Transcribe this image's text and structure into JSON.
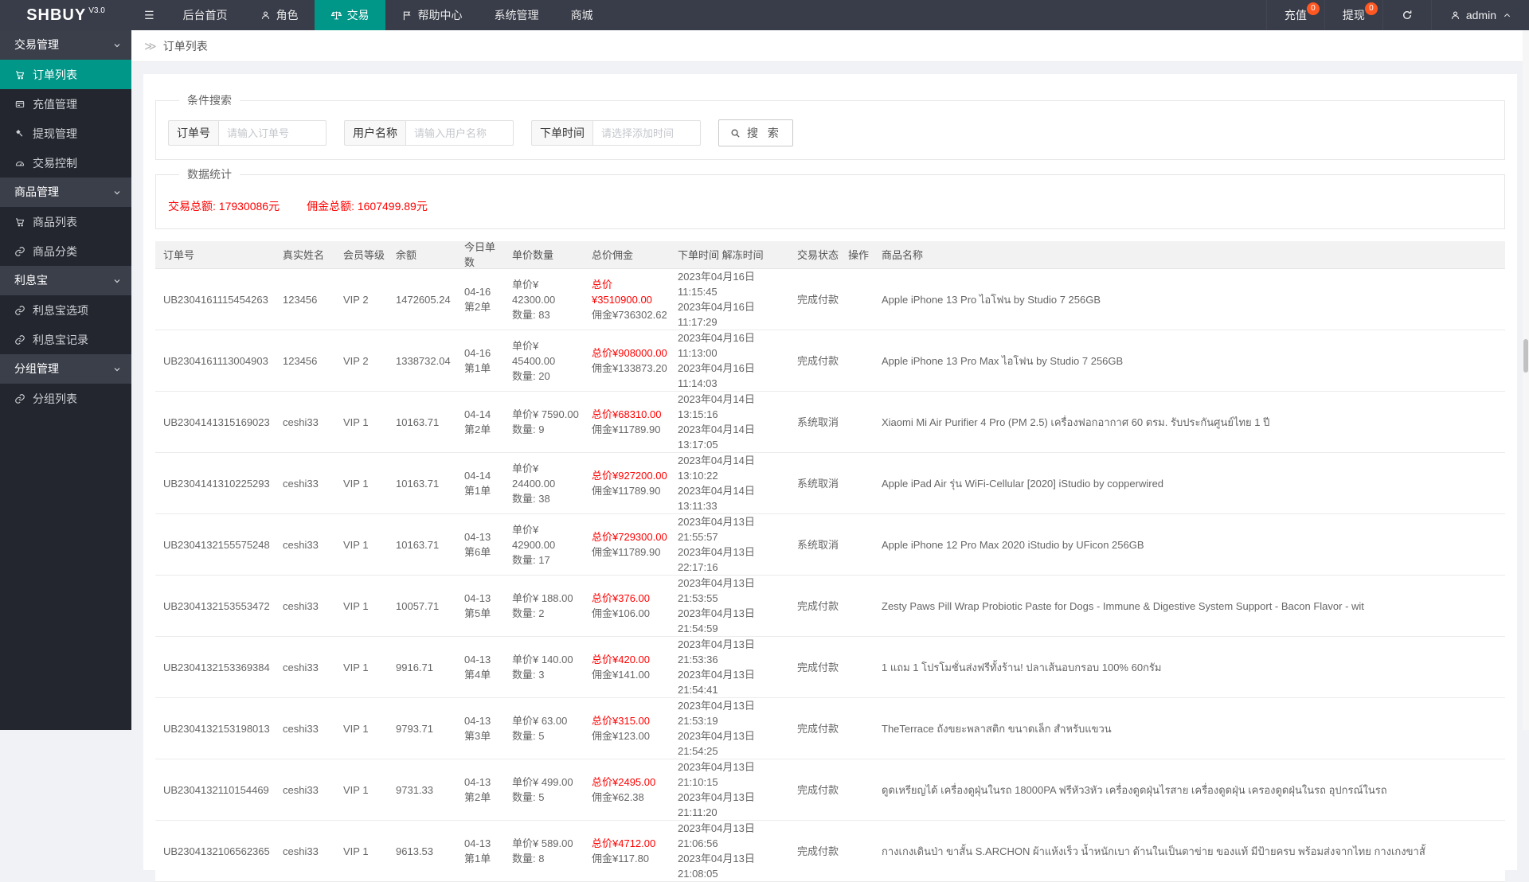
{
  "colors": {
    "accent": "#009688",
    "badge": "#ff5722",
    "alert_red": "#ff0000"
  },
  "topbar": {
    "logo": "SHBUY",
    "logo_version": "V3.0",
    "menu": [
      {
        "label": "后台首页"
      },
      {
        "label": "角色",
        "icon": "person-icon"
      },
      {
        "label": "交易",
        "icon": "scales-icon",
        "active": true
      },
      {
        "label": "帮助中心",
        "icon": "flag-icon"
      },
      {
        "label": "系统管理"
      },
      {
        "label": "商城"
      }
    ],
    "right": {
      "recharge_label": "充值",
      "recharge_badge": "0",
      "withdraw_label": "提现",
      "withdraw_badge": "0",
      "username": "admin"
    }
  },
  "sidebar": {
    "items": [
      {
        "type": "group",
        "label": "交易管理"
      },
      {
        "type": "item",
        "label": "订单列表",
        "icon": "cart-icon",
        "active": true
      },
      {
        "type": "item",
        "label": "充值管理",
        "icon": "card-icon"
      },
      {
        "type": "item",
        "label": "提现管理",
        "icon": "gavel-icon"
      },
      {
        "type": "item",
        "label": "交易控制",
        "icon": "gauge-icon"
      },
      {
        "type": "group",
        "label": "商品管理"
      },
      {
        "type": "item",
        "label": "商品列表",
        "icon": "cart-icon"
      },
      {
        "type": "item",
        "label": "商品分类",
        "icon": "link-icon"
      },
      {
        "type": "group",
        "label": "利息宝"
      },
      {
        "type": "item",
        "label": "利息宝选项",
        "icon": "link-icon"
      },
      {
        "type": "item",
        "label": "利息宝记录",
        "icon": "link-icon"
      },
      {
        "type": "group",
        "label": "分组管理"
      },
      {
        "type": "item",
        "label": "分组列表",
        "icon": "link-icon"
      }
    ]
  },
  "breadcrumb": {
    "page": "订单列表"
  },
  "search": {
    "legend": "条件搜索",
    "fields": [
      {
        "label": "订单号",
        "placeholder": "请输入订单号",
        "value": ""
      },
      {
        "label": "用户名称",
        "placeholder": "请输入用户名称",
        "value": ""
      },
      {
        "label": "下单时间",
        "placeholder": "请选择添加时间",
        "value": ""
      }
    ],
    "button_label": "搜 索"
  },
  "stats": {
    "legend": "数据统计",
    "trade_total": "交易总额: 17930086元",
    "commission_total": "佣金总额: 1607499.89元"
  },
  "table": {
    "headers": [
      "订单号",
      "真实姓名",
      "会员等级",
      "余额",
      "今日单数",
      "单价数量",
      "总价佣金",
      "下单时间 解冻时间",
      "交易状态",
      "操作",
      "商品名称"
    ],
    "rows": [
      {
        "order_no": "UB2304161115454263",
        "real_name": "123456",
        "vip": "VIP 2",
        "balance": "1472605.24",
        "date": "04-16",
        "seq": "第2单",
        "unit_price": "单价¥ 42300.00",
        "qty": "数量: 83",
        "total": "总价¥3510900.00",
        "commission": "佣金¥736302.62",
        "order_time": "2023年04月16日 11:15:45",
        "unfreeze_time": "2023年04月16日 11:17:29",
        "status": "完成付款",
        "product": "Apple iPhone 13 Pro ไอโฟน by Studio 7 256GB"
      },
      {
        "order_no": "UB2304161113004903",
        "real_name": "123456",
        "vip": "VIP 2",
        "balance": "1338732.04",
        "date": "04-16",
        "seq": "第1单",
        "unit_price": "单价¥ 45400.00",
        "qty": "数量: 20",
        "total": "总价¥908000.00",
        "commission": "佣金¥133873.20",
        "order_time": "2023年04月16日 11:13:00",
        "unfreeze_time": "2023年04月16日 11:14:03",
        "status": "完成付款",
        "product": "Apple iPhone 13 Pro Max ไอโฟน by Studio 7 256GB"
      },
      {
        "order_no": "UB2304141315169023",
        "real_name": "ceshi33",
        "vip": "VIP 1",
        "balance": "10163.71",
        "date": "04-14",
        "seq": "第2单",
        "unit_price": "单价¥ 7590.00",
        "qty": "数量: 9",
        "total": "总价¥68310.00",
        "commission": "佣金¥11789.90",
        "order_time": "2023年04月14日 13:15:16",
        "unfreeze_time": "2023年04月14日 13:17:05",
        "status": "系统取消",
        "product": "Xiaomi Mi Air Purifier 4 Pro (PM 2.5) เครื่องฟอกอากาศ 60 ตรม. รับประกันศูนย์ไทย 1 ปี"
      },
      {
        "order_no": "UB2304141310225293",
        "real_name": "ceshi33",
        "vip": "VIP 1",
        "balance": "10163.71",
        "date": "04-14",
        "seq": "第1单",
        "unit_price": "单价¥ 24400.00",
        "qty": "数量: 38",
        "total": "总价¥927200.00",
        "commission": "佣金¥11789.90",
        "order_time": "2023年04月14日 13:10:22",
        "unfreeze_time": "2023年04月14日 13:11:33",
        "status": "系统取消",
        "product": "Apple iPad Air รุ่น WiFi-Cellular [2020] iStudio by copperwired"
      },
      {
        "order_no": "UB2304132155575248",
        "real_name": "ceshi33",
        "vip": "VIP 1",
        "balance": "10163.71",
        "date": "04-13",
        "seq": "第6单",
        "unit_price": "单价¥ 42900.00",
        "qty": "数量: 17",
        "total": "总价¥729300.00",
        "commission": "佣金¥11789.90",
        "order_time": "2023年04月13日 21:55:57",
        "unfreeze_time": "2023年04月13日 22:17:16",
        "status": "系统取消",
        "product": "Apple iPhone 12 Pro Max 2020 iStudio by UFicon 256GB"
      },
      {
        "order_no": "UB2304132153553472",
        "real_name": "ceshi33",
        "vip": "VIP 1",
        "balance": "10057.71",
        "date": "04-13",
        "seq": "第5单",
        "unit_price": "单价¥ 188.00",
        "qty": "数量: 2",
        "total": "总价¥376.00",
        "commission": "佣金¥106.00",
        "order_time": "2023年04月13日 21:53:55",
        "unfreeze_time": "2023年04月13日 21:54:59",
        "status": "完成付款",
        "product": "Zesty Paws Pill Wrap Probiotic Paste for Dogs - Immune & Digestive System Support - Bacon Flavor - wit"
      },
      {
        "order_no": "UB2304132153369384",
        "real_name": "ceshi33",
        "vip": "VIP 1",
        "balance": "9916.71",
        "date": "04-13",
        "seq": "第4单",
        "unit_price": "单价¥ 140.00",
        "qty": "数量: 3",
        "total": "总价¥420.00",
        "commission": "佣金¥141.00",
        "order_time": "2023年04月13日 21:53:36",
        "unfreeze_time": "2023年04月13日 21:54:41",
        "status": "完成付款",
        "product": "1 แถม 1 โปรโมชั่นส่งฟรีทั้งร้าน! ปลาเส้นอบกรอบ 100% 60กรัม"
      },
      {
        "order_no": "UB2304132153198013",
        "real_name": "ceshi33",
        "vip": "VIP 1",
        "balance": "9793.71",
        "date": "04-13",
        "seq": "第3单",
        "unit_price": "单价¥ 63.00",
        "qty": "数量: 5",
        "total": "总价¥315.00",
        "commission": "佣金¥123.00",
        "order_time": "2023年04月13日 21:53:19",
        "unfreeze_time": "2023年04月13日 21:54:25",
        "status": "完成付款",
        "product": "TheTerrace ถังขยะพลาสติก ขนาดเล็ก สำหรับแขวน"
      },
      {
        "order_no": "UB2304132110154469",
        "real_name": "ceshi33",
        "vip": "VIP 1",
        "balance": "9731.33",
        "date": "04-13",
        "seq": "第2单",
        "unit_price": "单价¥ 499.00",
        "qty": "数量: 5",
        "total": "总价¥2495.00",
        "commission": "佣金¥62.38",
        "order_time": "2023年04月13日 21:10:15",
        "unfreeze_time": "2023年04月13日 21:11:20",
        "status": "完成付款",
        "product": "ดูดเหรียญได้ เครื่องดูฝุ่นในรถ 18000PA ฟรีหัว3หัว เครื่องดูดฝุ่นไรสาย เครื่องดูดฝุ่น เครองดูดฝุ่นในรถ อุปกรณ์ในรถ"
      },
      {
        "order_no": "UB2304132106562365",
        "real_name": "ceshi33",
        "vip": "VIP 1",
        "balance": "9613.53",
        "date": "04-13",
        "seq": "第1单",
        "unit_price": "单价¥ 589.00",
        "qty": "数量: 8",
        "total": "总价¥4712.00",
        "commission": "佣金¥117.80",
        "order_time": "2023年04月13日 21:06:56",
        "unfreeze_time": "2023年04月13日 21:08:05",
        "status": "完成付款",
        "product": "กางเกงเดินป่า ขาสั้น S.ARCHON ผ้าแห้งเร็ว น้ำหนักเบา ด้านในเป็นตาข่าย ของแท้ มีป้ายครบ พร้อมส่งจากไทย กางเกงขาสั้"
      }
    ]
  }
}
